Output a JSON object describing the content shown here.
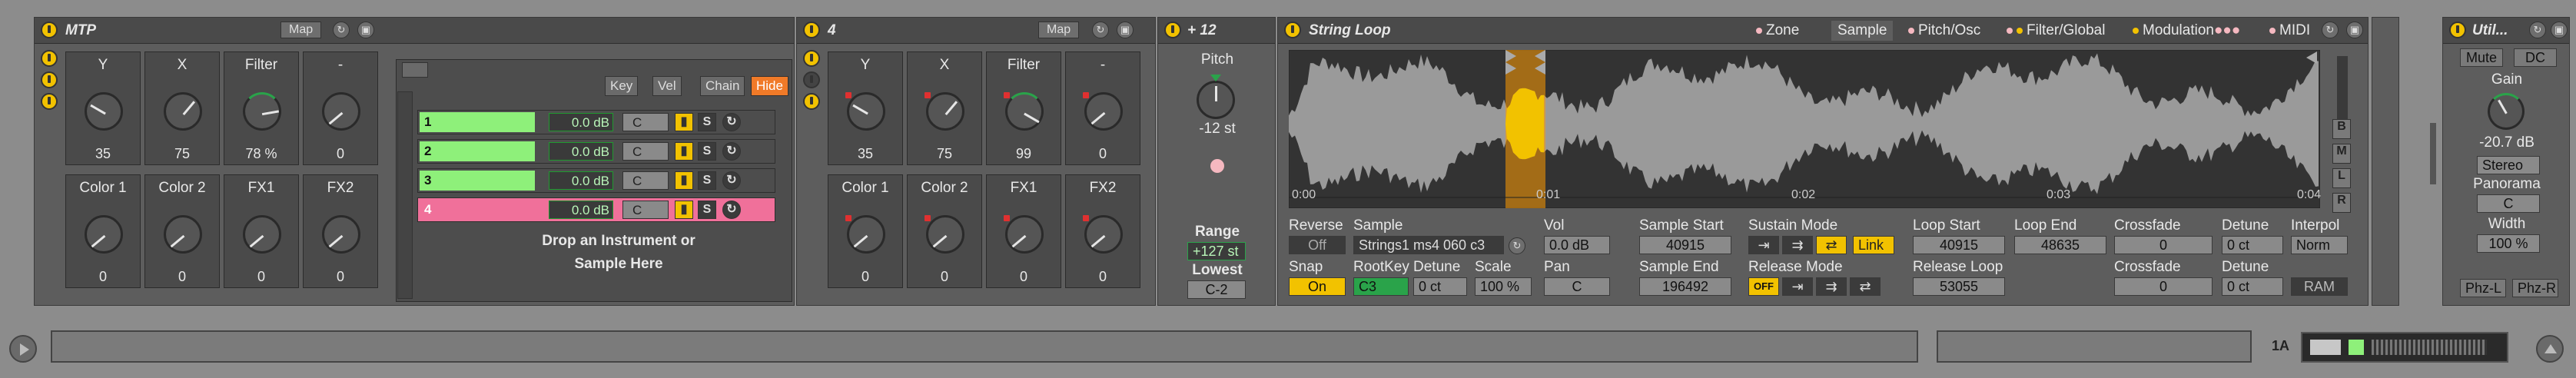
{
  "mtp": {
    "title": "MTP",
    "map_label": "Map",
    "macros": [
      {
        "label": "Y",
        "value": "35"
      },
      {
        "label": "X",
        "value": "75"
      },
      {
        "label": "Filter",
        "value": "78 %"
      },
      {
        "label": "-",
        "value": "0"
      },
      {
        "label": "Color 1",
        "value": "0"
      },
      {
        "label": "Color 2",
        "value": "0"
      },
      {
        "label": "FX1",
        "value": "0"
      },
      {
        "label": "FX2",
        "value": "0"
      }
    ],
    "chain_header": {
      "key": "Key",
      "vel": "Vel",
      "chain": "Chain",
      "hide": "Hide"
    },
    "chains": [
      {
        "name": "1",
        "vol": "0.0 dB",
        "pan": "C",
        "solo": "S"
      },
      {
        "name": "2",
        "vol": "0.0 dB",
        "pan": "C",
        "solo": "S"
      },
      {
        "name": "3",
        "vol": "0.0 dB",
        "pan": "C",
        "solo": "S"
      },
      {
        "name": "4",
        "vol": "0.0 dB",
        "pan": "C",
        "solo": "S"
      }
    ],
    "drop_text_1": "Drop an Instrument or",
    "drop_text_2": "Sample Here"
  },
  "rack4": {
    "title": "4",
    "map_label": "Map",
    "macros": [
      {
        "label": "Y",
        "value": "35"
      },
      {
        "label": "X",
        "value": "75"
      },
      {
        "label": "Filter",
        "value": "99"
      },
      {
        "label": "-",
        "value": "0"
      },
      {
        "label": "Color 1",
        "value": "0"
      },
      {
        "label": "Color 2",
        "value": "0"
      },
      {
        "label": "FX1",
        "value": "0"
      },
      {
        "label": "FX2",
        "value": "0"
      }
    ]
  },
  "pitch": {
    "title": "+ 12",
    "pitch_label": "Pitch",
    "pitch_value": "-12 st",
    "range_label": "Range",
    "range_value": "+127 st",
    "lowest_label": "Lowest",
    "lowest_value": "C-2"
  },
  "sampler": {
    "title": "String Loop",
    "tabs": [
      "Zone",
      "Sample",
      "Pitch/Osc",
      "Filter/Global",
      "Modulation",
      "MIDI"
    ],
    "time_marks": [
      "0:00",
      "0:01",
      "0:02",
      "0:03",
      "0:04"
    ],
    "side_buttons": [
      "B",
      "M",
      "L",
      "R"
    ],
    "reverse_label": "Reverse",
    "reverse_value": "Off",
    "snap_label": "Snap",
    "snap_value": "On",
    "sample_label": "Sample",
    "sample_value": "Strings1 ms4 060 c3",
    "rootkey_label": "RootKey",
    "rootkey_value": "C3",
    "detune_label": "Detune",
    "detune_value": "0 ct",
    "scale_label": "Scale",
    "scale_value": "100 %",
    "vol_label": "Vol",
    "vol_value": "0.0 dB",
    "pan_label": "Pan",
    "pan_value": "C",
    "sample_start_label": "Sample Start",
    "sample_start_value": "40915",
    "sample_end_label": "Sample End",
    "sample_end_value": "196492",
    "sustain_mode_label": "Sustain Mode",
    "link_label": "Link",
    "release_mode_label": "Release Mode",
    "release_off": "OFF",
    "loop_start_label": "Loop Start",
    "loop_start_value": "40915",
    "loop_end_label": "Loop End",
    "loop_end_value": "48635",
    "release_loop_label": "Release Loop",
    "release_loop_value": "53055",
    "crossfade_label": "Crossfade",
    "crossfade_value": "0",
    "crossfade2_label": "Crossfade",
    "crossfade2_value": "0",
    "detune2_label": "Detune",
    "detune2_value": "0 ct",
    "detune3_label": "Detune",
    "detune3_value": "0 ct",
    "interpol_label": "Interpol",
    "interpol_value": "Norm",
    "ram_label": "RAM"
  },
  "utility": {
    "title": "Util...",
    "mute_label": "Mute",
    "dc_label": "DC",
    "gain_label": "Gain",
    "gain_value": "-20.7 dB",
    "stereo_value": "Stereo",
    "panorama_label": "Panorama",
    "panorama_value": "C",
    "width_label": "Width",
    "width_value": "100 %",
    "phz_l": "Phz-L",
    "phz_r": "Phz-R"
  },
  "status": {
    "key_label": "1A"
  }
}
